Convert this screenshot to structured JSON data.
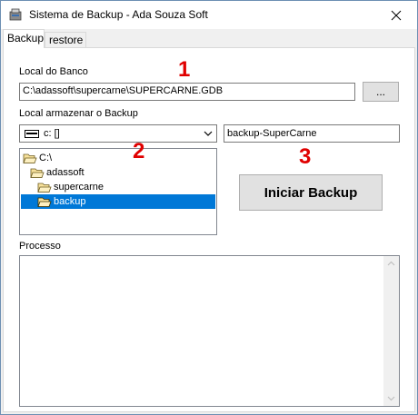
{
  "window": {
    "title": "Sistema de Backup - Ada Souza Soft"
  },
  "tabs": [
    {
      "label": "Backup",
      "active": true
    },
    {
      "label": "restore",
      "active": false
    }
  ],
  "backup": {
    "db_label": "Local do Banco",
    "db_path": "C:\\adassoft\\supercarne\\SUPERCARNE.GDB",
    "browse_label": "...",
    "dest_label": "Local armazenar o Backup",
    "drive_value": "c: []",
    "backup_name": "backup-SuperCarne",
    "folders": [
      {
        "label": "C:\\",
        "level": 0,
        "selected": false
      },
      {
        "label": "adassoft",
        "level": 1,
        "selected": false
      },
      {
        "label": "supercarne",
        "level": 2,
        "selected": false
      },
      {
        "label": "backup",
        "level": 3,
        "selected": true
      }
    ],
    "start_button": "Iniciar Backup",
    "process_label": "Processo",
    "process_text": ""
  },
  "annotations": [
    "1",
    "2",
    "3"
  ],
  "colors": {
    "selection": "#0078d7",
    "annotation": "#e00000",
    "window_border": "#6d8fb3"
  }
}
